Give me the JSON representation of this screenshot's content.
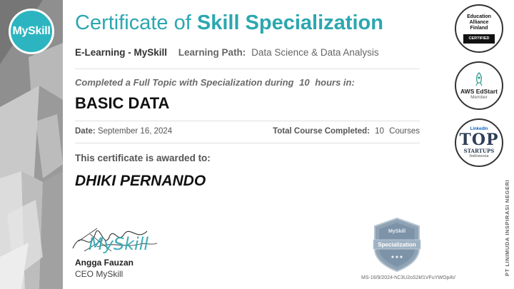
{
  "logo": {
    "text": "MySkill"
  },
  "title": {
    "prefix": "Certificate of",
    "emphasis": "Skill Specialization"
  },
  "subtitle": {
    "org": "E-Learning - MySkill",
    "learning_path_label": "Learning Path:",
    "learning_path_value": "Data Science & Data Analysis"
  },
  "completion": {
    "text_before": "Completed a Full Topic with Specialization during",
    "hours": "10",
    "text_after": "hours in:"
  },
  "topic": "BASIC DATA",
  "date": {
    "label": "Date:",
    "value": "September 16, 2024"
  },
  "total": {
    "label": "Total Course Completed:",
    "count": "10",
    "unit": "Courses"
  },
  "awarded_label": "This certificate is awarded to:",
  "recipient": "DHIKI PERNANDO",
  "signer": {
    "signature_text": "MySkill",
    "name": "Angga Fauzan",
    "role": "CEO MySkill"
  },
  "specialization_badge": {
    "brand": "MySkill",
    "label": "Specialization"
  },
  "certificate_id": "MS-16/9/2024-hC3U2oS2kf1VFuYWOpAV",
  "badges": {
    "efa": {
      "line1": "Education",
      "line2": "Alliance",
      "line3": "Finland",
      "bar": "CERTIFIED"
    },
    "aws": {
      "title": "AWS EdStart",
      "sub": "Member"
    },
    "top": {
      "tag": "LinkedIn",
      "big": "TOP",
      "mid": "STARTUPS",
      "small": "Indonesia"
    }
  },
  "vertical_text": "PT LINIMUDA INSPIRASI NEGERI",
  "colors": {
    "accent": "#2ba7b0",
    "logo_bg": "#2cb5c0",
    "shield": "#8fa3b5",
    "linkedin": "#0a66c2"
  }
}
